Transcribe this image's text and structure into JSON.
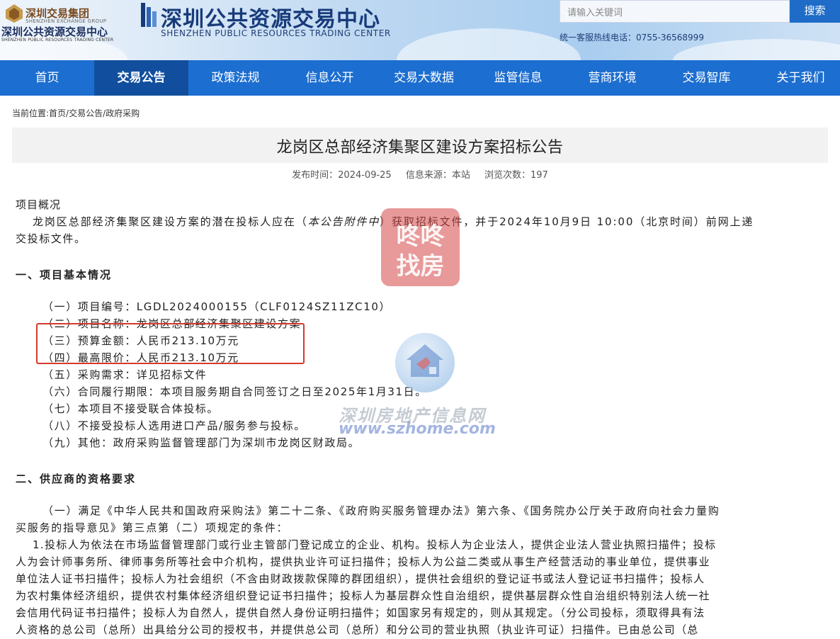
{
  "header": {
    "group_logo": {
      "line1": "深圳交易集团",
      "line2": "SHENZHEN EXCHANGE GROUP",
      "line3": "深圳公共资源交易中心",
      "line4": "SHENZHEN PUBLIC RESOURCES TRADING CENTER"
    },
    "site_title": "深圳公共资源交易中心",
    "site_title_en": "SHENZHEN PUBLIC RESOURCES TRADING CENTER",
    "search_placeholder": "请输入关键词",
    "search_button": "搜索",
    "hotline": "统一客服热线电话：0755-36568999"
  },
  "nav": {
    "items": [
      {
        "label": "首页"
      },
      {
        "label": "交易公告"
      },
      {
        "label": "政策法规"
      },
      {
        "label": "信息公开"
      },
      {
        "label": "交易大数据"
      },
      {
        "label": "监管信息"
      },
      {
        "label": "营商环境"
      },
      {
        "label": "交易智库"
      },
      {
        "label": "关于我们"
      }
    ],
    "active_index": 1
  },
  "breadcrumb": "当前位置:首页/交易公告/政府采购",
  "article": {
    "title": "龙岗区总部经济集聚区建设方案招标公告",
    "publish_time": "发布时间：2024-09-25",
    "source": "信息来源：本站",
    "views": "浏览次数：197",
    "overview_heading": "项目概况",
    "overview_text_1": "龙岗区总部经济集聚区建设方案的潜在投标人应在（",
    "overview_text_italic": "本公告附件中",
    "overview_text_2": "）获取招标文件，并于2024年10月9日 10:00（北京时间）前网上递",
    "overview_text_3": "交投标文件。",
    "section1_heading": "一、项目基本情况",
    "section1_items": [
      "（一）项目编号：LGDL2024000155（CLF0124SZ11ZC10）",
      "（二）项目名称：龙岗区总部经济集聚区建设方案",
      "（三）预算金额：人民币213.10万元",
      "（四）最高限价：人民币213.10万元",
      "（五）采购需求：详见招标文件",
      "（六）合同履行期限：本项目服务期自合同签订之日至2025年1月31日。",
      "（七）本项目不接受联合体投标。",
      "（八）不接受投标人选用进口产品/服务参与投标。",
      "（九）其他：政府采购监督管理部门为深圳市龙岗区财政局。"
    ],
    "section2_heading": "二、供应商的资格要求",
    "section2_lines": [
      "（一）满足《中华人民共和国政府采购法》第二十二条、《政府购买服务管理办法》第六条、《国务院办公厅关于政府向社会力量购",
      "买服务的指导意见》第三点第（二）项规定的条件：",
      "1.投标人为依法在市场监督管理部门或行业主管部门登记成立的企业、机构。投标人为企业法人，提供企业法人营业执照扫描件；投标",
      "人为会计师事务所、律师事务所等社会中介机构，提供执业许可证扫描件；投标人为公益二类或从事生产经营活动的事业单位，提供事业",
      "单位法人证书扫描件；投标人为社会组织（不含由财政拨款保障的群团组织），提供社会组织的登记证书或法人登记证书扫描件；投标人",
      "为农村集体经济组织，提供农村集体经济组织登记证书扫描件；投标人为基层群众性自治组织，提供基层群众性自治组织特别法人统一社",
      "会信用代码证书扫描件；投标人为自然人，提供自然人身份证明扫描件；如国家另有规定的，则从其规定。（分公司投标，须取得具有法",
      "人资格的总公司（总所）出具给分公司的授权书，并提供总公司（总所）和分公司的营业执照（执业许可证）扫描件。已由总公司（总"
    ]
  },
  "watermarks": {
    "badge_line1": "咚咚",
    "badge_line2": "找房",
    "site_cn": "深圳房地产信息网",
    "site_url": "www.szhome.com"
  },
  "colors": {
    "nav_bg": "#1c6ed0",
    "nav_active_bg": "#114f9e",
    "highlight_border": "#d6382d"
  }
}
